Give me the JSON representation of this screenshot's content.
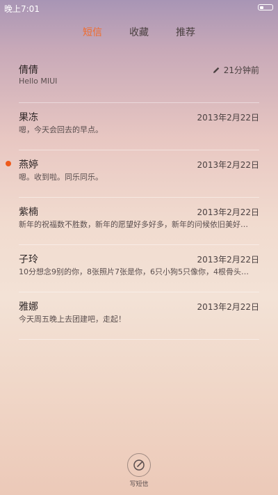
{
  "status_bar": {
    "time": "晚上7:01",
    "battery_level": 0.3
  },
  "tabs": [
    {
      "label": "短信",
      "active": true
    },
    {
      "label": "收藏",
      "active": false
    },
    {
      "label": "推荐",
      "active": false
    }
  ],
  "messages": [
    {
      "name": "倩倩",
      "time": "21分钟前",
      "snippet": "Hello MIUI",
      "draft": true,
      "unread": false
    },
    {
      "name": "果冻",
      "time": "2013年2月22日",
      "snippet": "嗯，今天会回去的早点。",
      "draft": false,
      "unread": false
    },
    {
      "name": "燕婷",
      "time": "2013年2月22日",
      "snippet": "嗯。收到啦。同乐同乐。",
      "draft": false,
      "unread": true
    },
    {
      "name": "紫楠",
      "time": "2013年2月22日",
      "snippet": "新年的祝福数不胜数，新年的愿望好多好多，新年的问候依旧美好…",
      "draft": false,
      "unread": false
    },
    {
      "name": "子玲",
      "time": "2013年2月22日",
      "snippet": "10分想念9别的你，8张照片7张是你，6只小狗5只像你，4根骨头…",
      "draft": false,
      "unread": false
    },
    {
      "name": "雅娜",
      "time": "2013年2月22日",
      "snippet": "今天周五晚上去团建吧，走起！",
      "draft": false,
      "unread": false
    }
  ],
  "compose": {
    "label": "写短信",
    "icon": "compose-icon"
  },
  "colors": {
    "accent": "#f06b2c",
    "unread_dot": "#ee5a1c"
  }
}
